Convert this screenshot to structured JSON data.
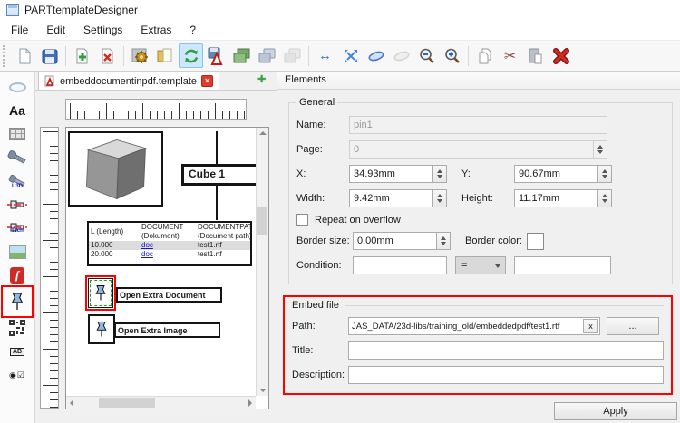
{
  "window": {
    "title": "PARTtemplateDesigner"
  },
  "menu": {
    "items": [
      "File",
      "Edit",
      "Settings",
      "Extras",
      "?"
    ]
  },
  "toolbar": {
    "icons": [
      "new-document",
      "save",
      "add",
      "remove",
      "settings",
      "notes",
      "refresh",
      "export-pdf",
      "images",
      "duplicate",
      "duplicate-alt",
      "resize-horizontal",
      "fit-view",
      "undo",
      "redo",
      "zoom-out",
      "zoom-in",
      "copy",
      "cut",
      "paste",
      "delete"
    ],
    "active_icon": "refresh"
  },
  "glyphs": {
    "gear": "⚙",
    "h_arrow": "↔",
    "scissors": "✂",
    "delete_x": "✗",
    "text_tool": "Aa",
    "u3d": "U3D",
    "tech": "Tech",
    "form_ab": "AB",
    "radio_check": "◉☑",
    "tab_close": "×",
    "new_tab": "+"
  },
  "sidebar": {
    "tools": [
      "ellipse-tool",
      "text-tool",
      "table-tool",
      "screw-3d-tool",
      "u3d-tool",
      "dimension-2d-tool",
      "dimension-tech-tool",
      "image-tool",
      "flash-tool",
      "pin-tool",
      "qrcode-tool",
      "form-field-tool",
      "radio-check-tool"
    ],
    "active_tool": "pin-tool"
  },
  "tab": {
    "label": "embeddocumentinpdf.template"
  },
  "canvas": {
    "cube_label": "Cube 1",
    "table": {
      "headers": [
        {
          "line1": "L (Length)",
          "line2": ""
        },
        {
          "line1": "DOCUMENT",
          "line2": "(Dokument)"
        },
        {
          "line1": "DOCUMENTPATH",
          "line2": "(Document path)"
        }
      ],
      "rows": [
        {
          "len": "10.000",
          "doc": "doc",
          "path": "test1.rtf"
        },
        {
          "len": "20.000",
          "doc": "doc",
          "path": "test1.rtf"
        }
      ]
    },
    "buttons": {
      "open_document": "Open Extra Document",
      "open_image": "Open Extra Image"
    }
  },
  "panel": {
    "header": "Elements",
    "general": {
      "legend": "General",
      "name_label": "Name:",
      "name_value": "pin1",
      "page_label": "Page:",
      "page_value": "0",
      "x_label": "X:",
      "x_value": "34.93mm",
      "y_label": "Y:",
      "y_value": "90.67mm",
      "width_label": "Width:",
      "width_value": "9.42mm",
      "height_label": "Height:",
      "height_value": "11.17mm",
      "repeat_label": "Repeat on overflow",
      "border_size_label": "Border size:",
      "border_size_value": "0.00mm",
      "border_color_label": "Border color:",
      "condition_label": "Condition:",
      "condition_value_1": "",
      "condition_op": "=",
      "condition_value_2": ""
    },
    "embed": {
      "legend": "Embed file",
      "path_label": "Path:",
      "path_value": "JAS_DATA/23d-libs/training_old/embeddedpdf/test1.rtf",
      "clear_button": "x",
      "browse_button": "...",
      "title_label": "Title:",
      "title_value": "",
      "description_label": "Description:",
      "description_value": ""
    },
    "apply_button": "Apply"
  }
}
